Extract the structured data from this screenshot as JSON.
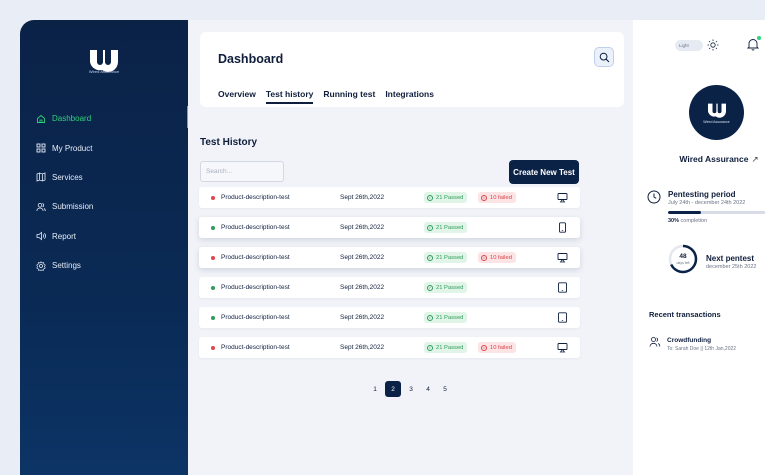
{
  "brand": {
    "logo_caption": "Wired Assurance"
  },
  "sidebar": {
    "items": [
      {
        "label": "Dashboard",
        "icon": "home-icon",
        "active": true
      },
      {
        "label": "My Product",
        "icon": "grid-icon",
        "active": false
      },
      {
        "label": "Services",
        "icon": "map-icon",
        "active": false
      },
      {
        "label": "Submission",
        "icon": "users-icon",
        "active": false
      },
      {
        "label": "Report",
        "icon": "speaker-icon",
        "active": false
      },
      {
        "label": "Settings",
        "icon": "gear-icon",
        "active": false
      }
    ]
  },
  "header": {
    "title": "Dashboard",
    "tabs": [
      {
        "label": "Overview",
        "active": false
      },
      {
        "label": "Test history",
        "active": true
      },
      {
        "label": "Running test",
        "active": false
      },
      {
        "label": "Integrations",
        "active": false
      }
    ]
  },
  "test_history": {
    "title": "Test History",
    "search_placeholder": "Search...",
    "create_label": "Create New Test",
    "rows": [
      {
        "status": "failed",
        "name": "Product-description-test",
        "date": "Sept 26th,2022",
        "passed": "21 Passed",
        "failed": "10 failed",
        "device": "monitor-icon"
      },
      {
        "status": "passed",
        "name": "Product-description-test",
        "date": "Sept 26th,2022",
        "passed": "21 Passed",
        "failed": "",
        "device": "mobile-icon"
      },
      {
        "status": "failed",
        "name": "Product-description-test",
        "date": "Sept 26th,2022",
        "passed": "21 Passed",
        "failed": "10 failed",
        "device": "monitor-icon"
      },
      {
        "status": "passed",
        "name": "Product-description-test",
        "date": "Sept 26th,2022",
        "passed": "21 Passed",
        "failed": "",
        "device": "tablet-icon"
      },
      {
        "status": "passed",
        "name": "Product-description-test",
        "date": "Sept 26th,2022",
        "passed": "21 Passed",
        "failed": "",
        "device": "tablet-icon"
      },
      {
        "status": "failed",
        "name": "Product-description-test",
        "date": "Sept 26th,2022",
        "passed": "21 Passed",
        "failed": "10 failed",
        "device": "monitor-icon"
      }
    ],
    "pages": [
      "1",
      "2",
      "3",
      "4",
      "5"
    ],
    "current_page": "2"
  },
  "right_panel": {
    "theme_label": "Light",
    "org_name": "Wired Assurance",
    "avatar_caption": "Wired Assurance",
    "period_title": "Pentesting period",
    "period_dates": "July 24th - december 24th 2022",
    "completion_value": "30%",
    "completion_label": "completion",
    "completion_fraction": 0.3,
    "next_days": "48",
    "next_days_unit": "days left",
    "next_title": "Next pentest",
    "next_date": "december 25th 2022",
    "recent_title": "Recent transactions",
    "transaction_title": "Crowdfunding",
    "transaction_sub": "To: Sarah Doe || 12th Jan,2022"
  },
  "colors": {
    "navy": "#0b2247",
    "accent_green": "#2fd27a",
    "fail_red": "#e0444c",
    "pass_green": "#2f9b5a"
  }
}
